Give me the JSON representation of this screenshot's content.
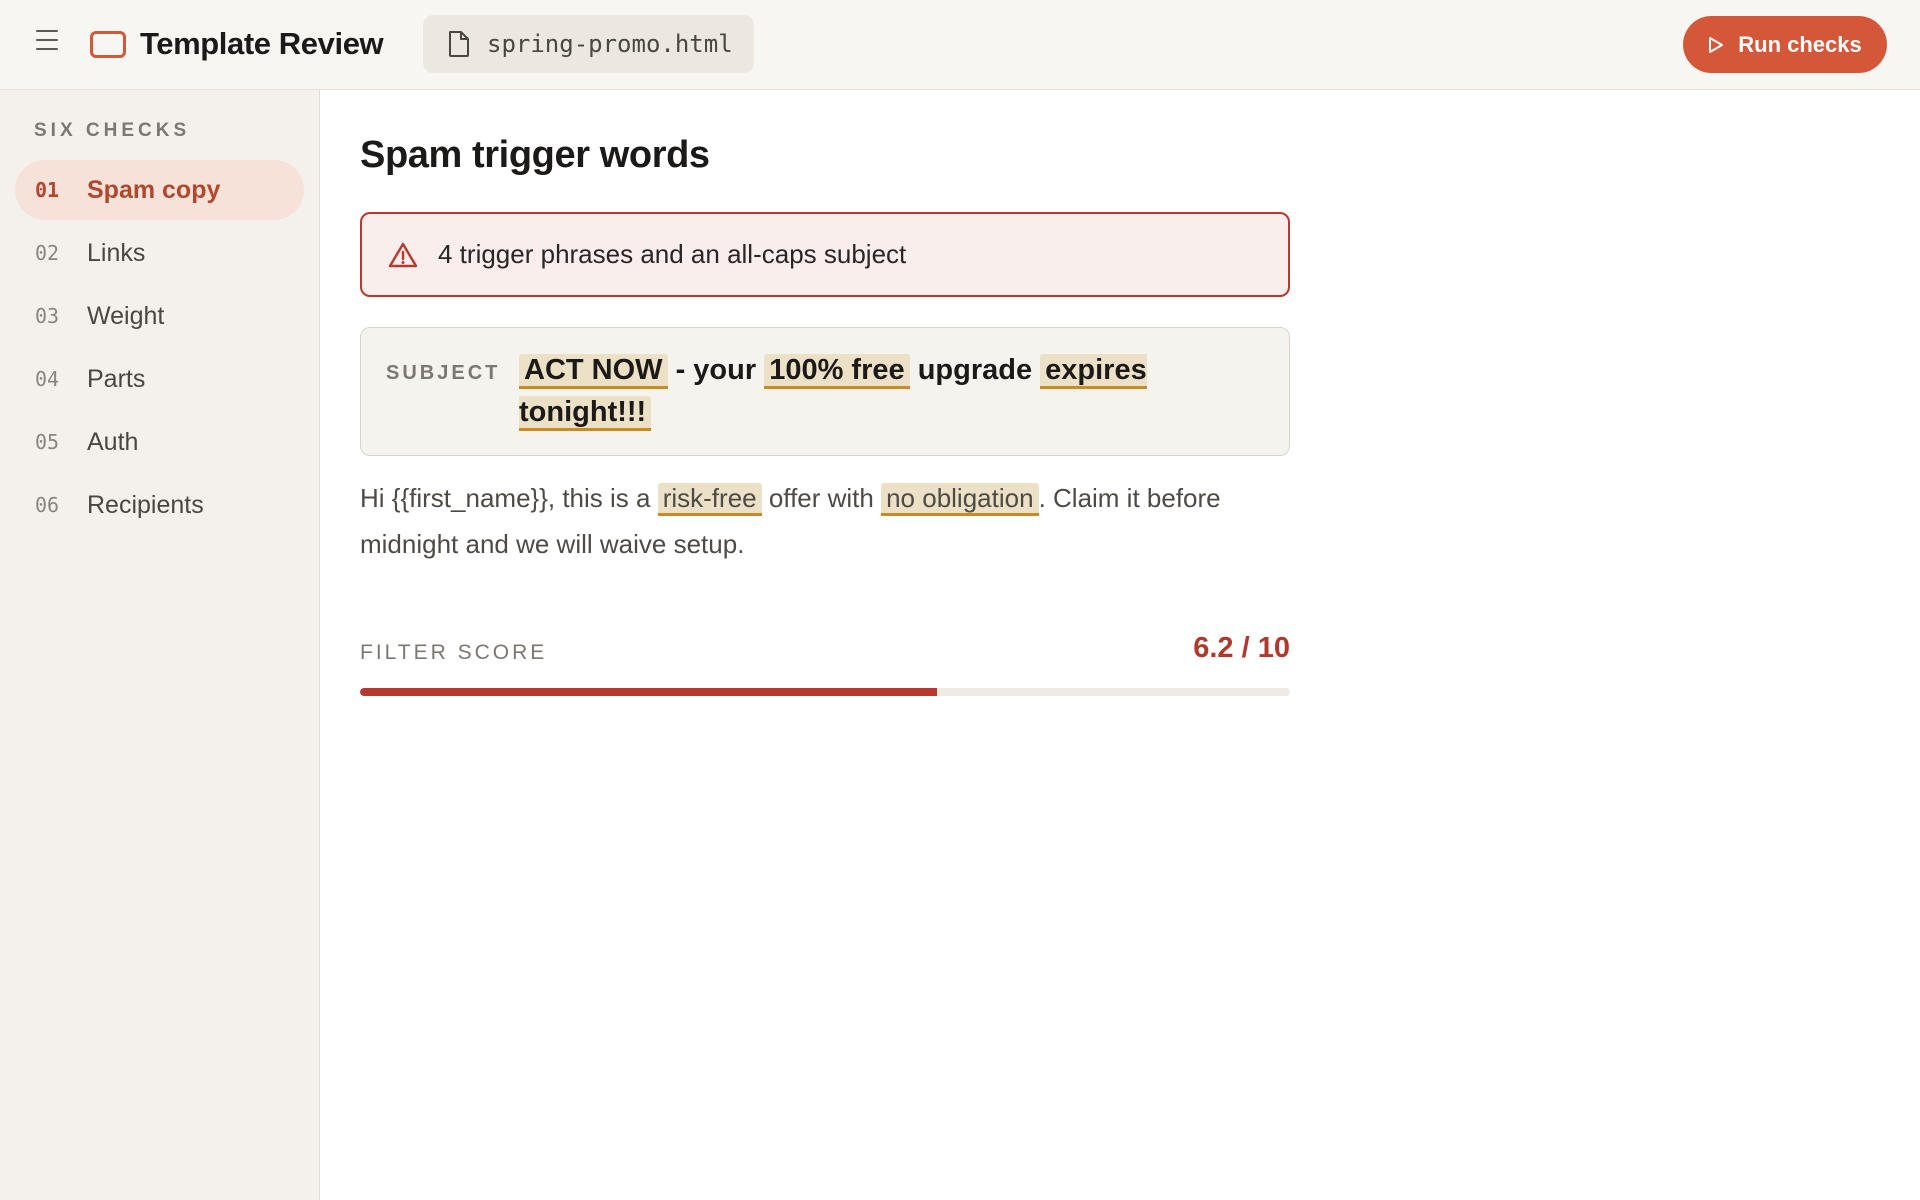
{
  "app": {
    "title": "Template Review",
    "file_name": "spring-promo.html",
    "run_button_label": "Run checks",
    "accent_color": "#d4573a"
  },
  "sidebar": {
    "heading": "SIX CHECKS",
    "items": [
      {
        "num": "01",
        "label": "Spam copy",
        "active": true
      },
      {
        "num": "02",
        "label": "Links",
        "active": false
      },
      {
        "num": "03",
        "label": "Weight",
        "active": false
      },
      {
        "num": "04",
        "label": "Parts",
        "active": false
      },
      {
        "num": "05",
        "label": "Auth",
        "active": false
      },
      {
        "num": "06",
        "label": "Recipients",
        "active": false
      }
    ]
  },
  "check": {
    "title": "Spam trigger words",
    "alert_text": "4 trigger phrases and an all-caps subject",
    "subject_label": "SUBJECT",
    "subject": {
      "t1": "ACT NOW",
      "t2": " - your ",
      "t3": "100% free",
      "t4": " upgrade ",
      "t5": "expires tonight!!!"
    },
    "body": {
      "t1": "Hi {{first_name}}, this is a ",
      "t2": "risk-free",
      "t3": " offer with ",
      "t4": "no obligation",
      "t5": ". Claim it before midnight and we will waive setup."
    },
    "score_label": "FILTER SCORE",
    "score_text": "6.2 / 10",
    "score_value": 6.2,
    "score_max": 10,
    "score_color": "#b8382f"
  }
}
